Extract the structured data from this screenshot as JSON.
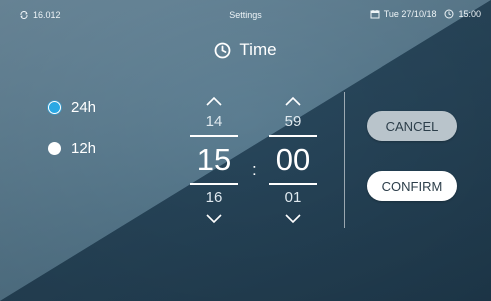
{
  "status_bar": {
    "sync_value": "16.012",
    "title": "Settings",
    "date": "Tue 27/10/18",
    "time": "15:00"
  },
  "page": {
    "title": "Time",
    "title_icon": "clock-icon"
  },
  "format_options": [
    {
      "label": "24h",
      "selected": true
    },
    {
      "label": "12h",
      "selected": false
    }
  ],
  "picker": {
    "hours": {
      "prev": "14",
      "current": "15",
      "next": "16"
    },
    "minutes": {
      "prev": "59",
      "current": "00",
      "next": "01"
    },
    "separator": ":"
  },
  "buttons": {
    "cancel": "CANCEL",
    "confirm": "CONFIRM"
  },
  "colors": {
    "accent": "#2aa8e4",
    "background_dark": "#1f3a4d",
    "background_light": "#6f8ea1",
    "cancel_button": "#b9c4cb",
    "confirm_button": "#ffffff"
  }
}
